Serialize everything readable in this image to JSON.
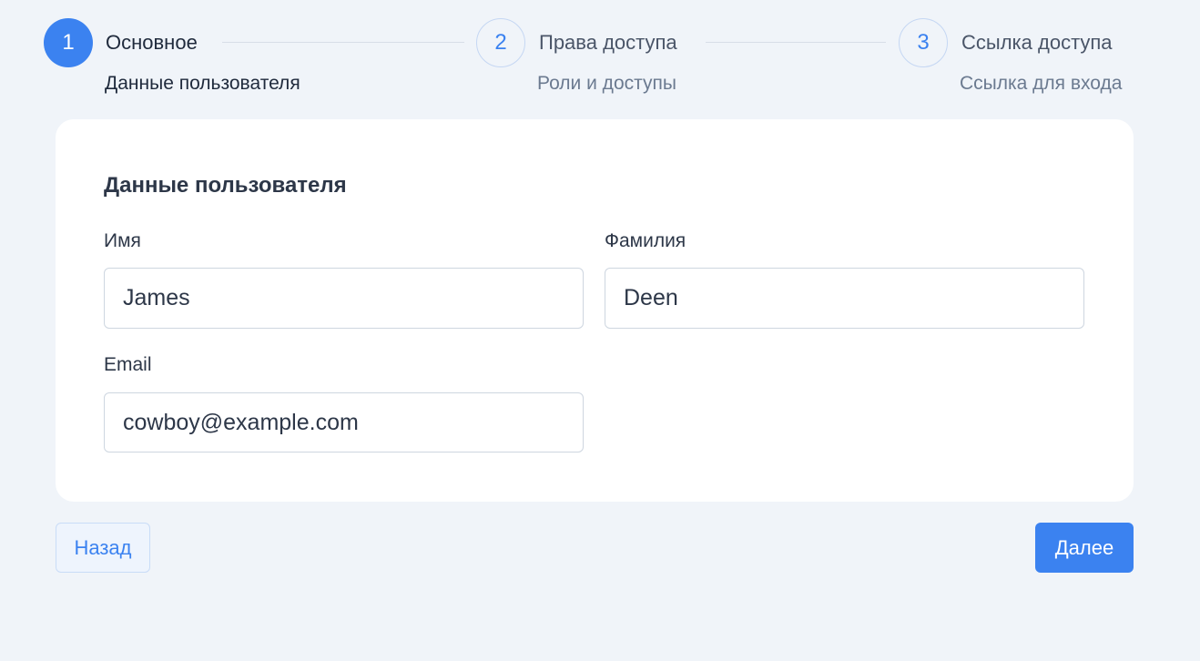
{
  "stepper": {
    "steps": [
      {
        "number": "1",
        "title": "Основное",
        "subtitle": "Данные пользователя",
        "state": "active"
      },
      {
        "number": "2",
        "title": "Права доступа",
        "subtitle": "Роли и доступы",
        "state": "inactive"
      },
      {
        "number": "3",
        "title": "Ссылка доступа",
        "subtitle": "Ссылка для входа",
        "state": "inactive"
      }
    ]
  },
  "form": {
    "title": "Данные пользователя",
    "first_name": {
      "label": "Имя",
      "value": "James"
    },
    "last_name": {
      "label": "Фамилия",
      "value": "Deen"
    },
    "email": {
      "label": "Email",
      "value": "cowboy@example.com"
    }
  },
  "actions": {
    "back_label": "Назад",
    "next_label": "Далее"
  },
  "colors": {
    "accent": "#3b82f0",
    "background": "#f0f4f9",
    "card": "#ffffff"
  }
}
